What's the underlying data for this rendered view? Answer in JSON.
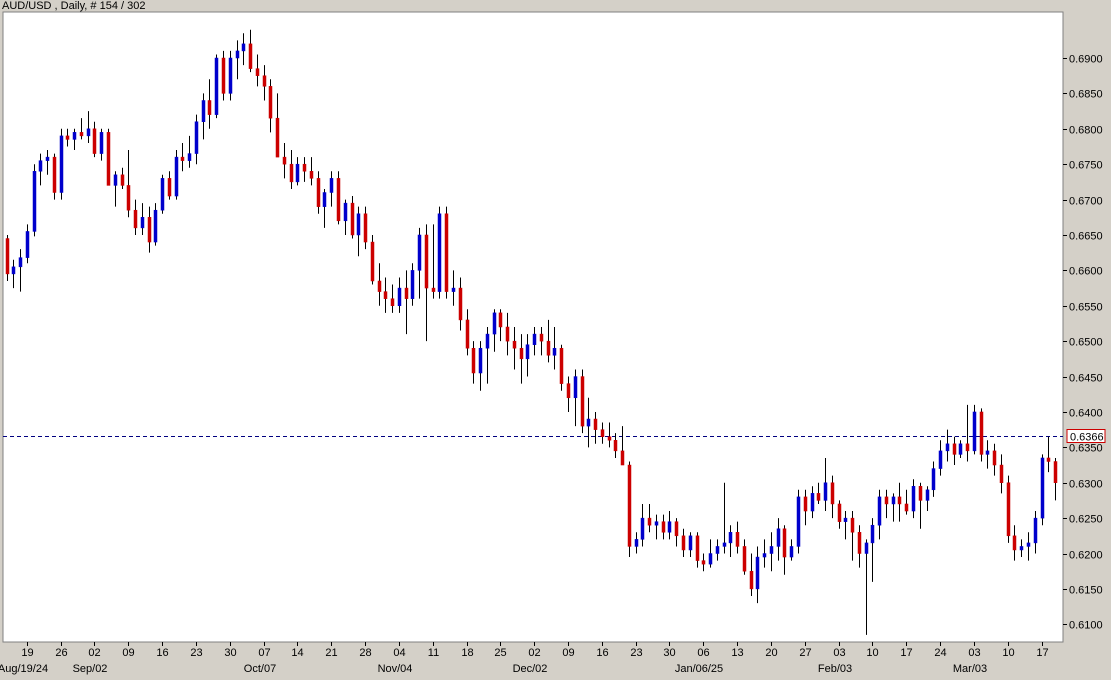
{
  "header": {
    "title": "AUD/USD , Daily, # 154 / 302"
  },
  "chart_data": {
    "type": "candlestick",
    "symbol": "AUD/USD",
    "timeframe": "Daily",
    "ylim": [
      0.6075,
      0.6965
    ],
    "y_ticks": [
      0.61,
      0.615,
      0.62,
      0.625,
      0.63,
      0.635,
      0.64,
      0.645,
      0.65,
      0.655,
      0.66,
      0.665,
      0.67,
      0.675,
      0.68,
      0.685,
      0.69
    ],
    "y_tick_labels": [
      "0.6100",
      "0.6150",
      "0.6200",
      "0.6250",
      "0.6300",
      "0.6350",
      "0.6400",
      "0.6450",
      "0.6500",
      "0.6550",
      "0.6600",
      "0.6650",
      "0.6700",
      "0.6750",
      "0.6800",
      "0.6850",
      "0.6900"
    ],
    "x_ticks": [
      {
        "i": 3,
        "label": "19"
      },
      {
        "i": 8,
        "label": "26"
      },
      {
        "i": 13,
        "label": "02"
      },
      {
        "i": 18,
        "label": "09"
      },
      {
        "i": 23,
        "label": "16"
      },
      {
        "i": 28,
        "label": "23"
      },
      {
        "i": 33,
        "label": "30"
      },
      {
        "i": 38,
        "label": "07"
      },
      {
        "i": 43,
        "label": "14"
      },
      {
        "i": 48,
        "label": "21"
      },
      {
        "i": 53,
        "label": "28"
      },
      {
        "i": 58,
        "label": "04"
      },
      {
        "i": 63,
        "label": "11"
      },
      {
        "i": 68,
        "label": "18"
      },
      {
        "i": 73,
        "label": "25"
      },
      {
        "i": 78,
        "label": "02"
      },
      {
        "i": 83,
        "label": "09"
      },
      {
        "i": 88,
        "label": "16"
      },
      {
        "i": 93,
        "label": "23"
      },
      {
        "i": 98,
        "label": "30"
      },
      {
        "i": 103,
        "label": "06"
      },
      {
        "i": 108,
        "label": "13"
      },
      {
        "i": 113,
        "label": "20"
      },
      {
        "i": 118,
        "label": "27"
      },
      {
        "i": 123,
        "label": "03"
      },
      {
        "i": 128,
        "label": "10"
      },
      {
        "i": 133,
        "label": "17"
      },
      {
        "i": 138,
        "label": "24"
      },
      {
        "i": 143,
        "label": "03"
      },
      {
        "i": 148,
        "label": "10"
      },
      {
        "i": 153,
        "label": "17"
      }
    ],
    "date_labels": [
      {
        "i": 3,
        "label": "Aug/19/24"
      },
      {
        "i": 13,
        "label": "Sep/02"
      },
      {
        "i": 38,
        "label": "Oct/07"
      },
      {
        "i": 58,
        "label": "Nov/04"
      },
      {
        "i": 78,
        "label": "Dec/02"
      },
      {
        "i": 103,
        "label": "Jan/06/25"
      },
      {
        "i": 123,
        "label": "Feb/03"
      },
      {
        "i": 143,
        "label": "Mar/03"
      }
    ],
    "current_price": 0.6366,
    "current_price_label": "0.6366",
    "colors": {
      "up": "#0000cc",
      "down": "#cc0000",
      "background": "#ffffff",
      "frame": "#d4d0c8",
      "price_line": "#000080"
    },
    "candles": [
      [
        0.6645,
        0.665,
        0.6585,
        0.6595
      ],
      [
        0.6595,
        0.6615,
        0.6575,
        0.6605
      ],
      [
        0.6605,
        0.663,
        0.657,
        0.6618
      ],
      [
        0.6618,
        0.6665,
        0.661,
        0.6655
      ],
      [
        0.6655,
        0.675,
        0.6648,
        0.674
      ],
      [
        0.674,
        0.6765,
        0.672,
        0.6755
      ],
      [
        0.6755,
        0.677,
        0.6735,
        0.676
      ],
      [
        0.676,
        0.6765,
        0.67,
        0.671
      ],
      [
        0.671,
        0.68,
        0.67,
        0.679
      ],
      [
        0.679,
        0.68,
        0.6775,
        0.6785
      ],
      [
        0.6785,
        0.68,
        0.677,
        0.6795
      ],
      [
        0.6795,
        0.6815,
        0.6785,
        0.679
      ],
      [
        0.679,
        0.6825,
        0.678,
        0.68
      ],
      [
        0.68,
        0.681,
        0.676,
        0.6765
      ],
      [
        0.6765,
        0.68,
        0.6755,
        0.6795
      ],
      [
        0.6795,
        0.68,
        0.675,
        0.672
      ],
      [
        0.672,
        0.674,
        0.669,
        0.6735
      ],
      [
        0.6735,
        0.6745,
        0.6715,
        0.672
      ],
      [
        0.672,
        0.677,
        0.6675,
        0.6685
      ],
      [
        0.6685,
        0.67,
        0.665,
        0.666
      ],
      [
        0.666,
        0.6695,
        0.665,
        0.6675
      ],
      [
        0.6675,
        0.669,
        0.6625,
        0.664
      ],
      [
        0.664,
        0.6695,
        0.6635,
        0.6685
      ],
      [
        0.6685,
        0.6735,
        0.668,
        0.673
      ],
      [
        0.673,
        0.674,
        0.67,
        0.6705
      ],
      [
        0.6705,
        0.677,
        0.67,
        0.676
      ],
      [
        0.676,
        0.678,
        0.674,
        0.6755
      ],
      [
        0.6755,
        0.679,
        0.6745,
        0.6765
      ],
      [
        0.6765,
        0.682,
        0.675,
        0.681
      ],
      [
        0.681,
        0.685,
        0.6785,
        0.684
      ],
      [
        0.684,
        0.687,
        0.68,
        0.682
      ],
      [
        0.682,
        0.6905,
        0.6815,
        0.69
      ],
      [
        0.69,
        0.691,
        0.684,
        0.685
      ],
      [
        0.685,
        0.691,
        0.684,
        0.69
      ],
      [
        0.69,
        0.6925,
        0.687,
        0.691
      ],
      [
        0.691,
        0.6935,
        0.689,
        0.692
      ],
      [
        0.692,
        0.694,
        0.688,
        0.6885
      ],
      [
        0.6885,
        0.6905,
        0.686,
        0.6875
      ],
      [
        0.6875,
        0.689,
        0.684,
        0.686
      ],
      [
        0.686,
        0.687,
        0.6795,
        0.6815
      ],
      [
        0.6815,
        0.685,
        0.678,
        0.676
      ],
      [
        0.676,
        0.678,
        0.673,
        0.675
      ],
      [
        0.675,
        0.677,
        0.6715,
        0.6725
      ],
      [
        0.6725,
        0.676,
        0.672,
        0.675
      ],
      [
        0.675,
        0.676,
        0.6725,
        0.674
      ],
      [
        0.674,
        0.676,
        0.672,
        0.673
      ],
      [
        0.673,
        0.674,
        0.668,
        0.669
      ],
      [
        0.669,
        0.6715,
        0.666,
        0.671
      ],
      [
        0.671,
        0.674,
        0.669,
        0.673
      ],
      [
        0.673,
        0.674,
        0.6665,
        0.667
      ],
      [
        0.667,
        0.67,
        0.665,
        0.6695
      ],
      [
        0.6695,
        0.6705,
        0.6645,
        0.665
      ],
      [
        0.665,
        0.669,
        0.662,
        0.668
      ],
      [
        0.668,
        0.669,
        0.663,
        0.664
      ],
      [
        0.664,
        0.665,
        0.658,
        0.6585
      ],
      [
        0.6585,
        0.661,
        0.655,
        0.657
      ],
      [
        0.657,
        0.659,
        0.654,
        0.656
      ],
      [
        0.656,
        0.658,
        0.654,
        0.655
      ],
      [
        0.655,
        0.659,
        0.654,
        0.6575
      ],
      [
        0.6575,
        0.66,
        0.651,
        0.656
      ],
      [
        0.656,
        0.661,
        0.655,
        0.66
      ],
      [
        0.66,
        0.666,
        0.656,
        0.665
      ],
      [
        0.665,
        0.6665,
        0.65,
        0.6575
      ],
      [
        0.6575,
        0.6665,
        0.656,
        0.657
      ],
      [
        0.657,
        0.669,
        0.656,
        0.668
      ],
      [
        0.668,
        0.669,
        0.656,
        0.657
      ],
      [
        0.657,
        0.66,
        0.655,
        0.6575
      ],
      [
        0.6575,
        0.659,
        0.6515,
        0.653
      ],
      [
        0.653,
        0.6545,
        0.648,
        0.649
      ],
      [
        0.649,
        0.65,
        0.644,
        0.6455
      ],
      [
        0.6455,
        0.65,
        0.643,
        0.649
      ],
      [
        0.649,
        0.652,
        0.644,
        0.651
      ],
      [
        0.651,
        0.6545,
        0.6485,
        0.654
      ],
      [
        0.654,
        0.6545,
        0.65,
        0.652
      ],
      [
        0.652,
        0.654,
        0.648,
        0.65
      ],
      [
        0.65,
        0.652,
        0.646,
        0.649
      ],
      [
        0.649,
        0.651,
        0.644,
        0.6475
      ],
      [
        0.6475,
        0.651,
        0.645,
        0.6495
      ],
      [
        0.6495,
        0.652,
        0.648,
        0.651
      ],
      [
        0.651,
        0.652,
        0.648,
        0.65
      ],
      [
        0.65,
        0.653,
        0.647,
        0.648
      ],
      [
        0.648,
        0.652,
        0.646,
        0.649
      ],
      [
        0.649,
        0.6495,
        0.643,
        0.644
      ],
      [
        0.644,
        0.645,
        0.64,
        0.642
      ],
      [
        0.642,
        0.646,
        0.638,
        0.645
      ],
      [
        0.645,
        0.646,
        0.637,
        0.638
      ],
      [
        0.638,
        0.642,
        0.635,
        0.639
      ],
      [
        0.639,
        0.64,
        0.6355,
        0.6375
      ],
      [
        0.6375,
        0.6385,
        0.6355,
        0.6365
      ],
      [
        0.6365,
        0.6385,
        0.635,
        0.636
      ],
      [
        0.636,
        0.637,
        0.6335,
        0.6345
      ],
      [
        0.6345,
        0.638,
        0.6335,
        0.6325
      ],
      [
        0.6325,
        0.633,
        0.6195,
        0.621
      ],
      [
        0.621,
        0.623,
        0.62,
        0.622
      ],
      [
        0.622,
        0.627,
        0.621,
        0.625
      ],
      [
        0.625,
        0.627,
        0.623,
        0.624
      ],
      [
        0.624,
        0.6255,
        0.622,
        0.6245
      ],
      [
        0.6245,
        0.6255,
        0.622,
        0.623
      ],
      [
        0.623,
        0.626,
        0.622,
        0.6245
      ],
      [
        0.6245,
        0.625,
        0.621,
        0.6225
      ],
      [
        0.6225,
        0.6235,
        0.6195,
        0.6205
      ],
      [
        0.6205,
        0.623,
        0.6195,
        0.6225
      ],
      [
        0.6225,
        0.623,
        0.618,
        0.619
      ],
      [
        0.619,
        0.62,
        0.6175,
        0.6185
      ],
      [
        0.6185,
        0.622,
        0.618,
        0.62
      ],
      [
        0.62,
        0.622,
        0.619,
        0.621
      ],
      [
        0.621,
        0.63,
        0.62,
        0.6215
      ],
      [
        0.6215,
        0.624,
        0.6195,
        0.623
      ],
      [
        0.623,
        0.6245,
        0.62,
        0.621
      ],
      [
        0.621,
        0.622,
        0.617,
        0.6175
      ],
      [
        0.6175,
        0.62,
        0.614,
        0.615
      ],
      [
        0.615,
        0.621,
        0.613,
        0.6195
      ],
      [
        0.6195,
        0.622,
        0.618,
        0.62
      ],
      [
        0.62,
        0.623,
        0.6175,
        0.621
      ],
      [
        0.621,
        0.625,
        0.619,
        0.6235
      ],
      [
        0.6235,
        0.624,
        0.617,
        0.6195
      ],
      [
        0.6195,
        0.622,
        0.619,
        0.621
      ],
      [
        0.621,
        0.629,
        0.62,
        0.628
      ],
      [
        0.628,
        0.629,
        0.624,
        0.626
      ],
      [
        0.626,
        0.6295,
        0.625,
        0.6285
      ],
      [
        0.6285,
        0.63,
        0.627,
        0.6275
      ],
      [
        0.6275,
        0.6335,
        0.626,
        0.63
      ],
      [
        0.63,
        0.631,
        0.625,
        0.627
      ],
      [
        0.627,
        0.6275,
        0.6235,
        0.6245
      ],
      [
        0.6245,
        0.626,
        0.622,
        0.625
      ],
      [
        0.625,
        0.626,
        0.619,
        0.623
      ],
      [
        0.623,
        0.624,
        0.618,
        0.62
      ],
      [
        0.62,
        0.622,
        0.6085,
        0.6215
      ],
      [
        0.6215,
        0.625,
        0.616,
        0.624
      ],
      [
        0.624,
        0.629,
        0.622,
        0.628
      ],
      [
        0.628,
        0.629,
        0.625,
        0.627
      ],
      [
        0.627,
        0.6285,
        0.6245,
        0.628
      ],
      [
        0.628,
        0.63,
        0.6245,
        0.627
      ],
      [
        0.627,
        0.629,
        0.6255,
        0.626
      ],
      [
        0.626,
        0.6305,
        0.625,
        0.6295
      ],
      [
        0.6295,
        0.63,
        0.6235,
        0.6275
      ],
      [
        0.6275,
        0.6295,
        0.626,
        0.629
      ],
      [
        0.629,
        0.633,
        0.628,
        0.632
      ],
      [
        0.632,
        0.636,
        0.631,
        0.6345
      ],
      [
        0.6345,
        0.6375,
        0.633,
        0.6355
      ],
      [
        0.6355,
        0.6365,
        0.6325,
        0.634
      ],
      [
        0.634,
        0.636,
        0.6335,
        0.6355
      ],
      [
        0.6355,
        0.641,
        0.633,
        0.6345
      ],
      [
        0.6345,
        0.641,
        0.634,
        0.64
      ],
      [
        0.64,
        0.6405,
        0.633,
        0.634
      ],
      [
        0.634,
        0.636,
        0.632,
        0.6345
      ],
      [
        0.6345,
        0.6355,
        0.631,
        0.6325
      ],
      [
        0.6325,
        0.634,
        0.6285,
        0.63
      ],
      [
        0.63,
        0.631,
        0.6215,
        0.6225
      ],
      [
        0.6225,
        0.624,
        0.619,
        0.6205
      ],
      [
        0.6205,
        0.622,
        0.6195,
        0.621
      ],
      [
        0.621,
        0.623,
        0.619,
        0.6215
      ],
      [
        0.6215,
        0.626,
        0.62,
        0.625
      ],
      [
        0.625,
        0.634,
        0.624,
        0.6335
      ],
      [
        0.6335,
        0.6365,
        0.6315,
        0.633
      ],
      [
        0.633,
        0.6335,
        0.6275,
        0.63
      ]
    ]
  }
}
